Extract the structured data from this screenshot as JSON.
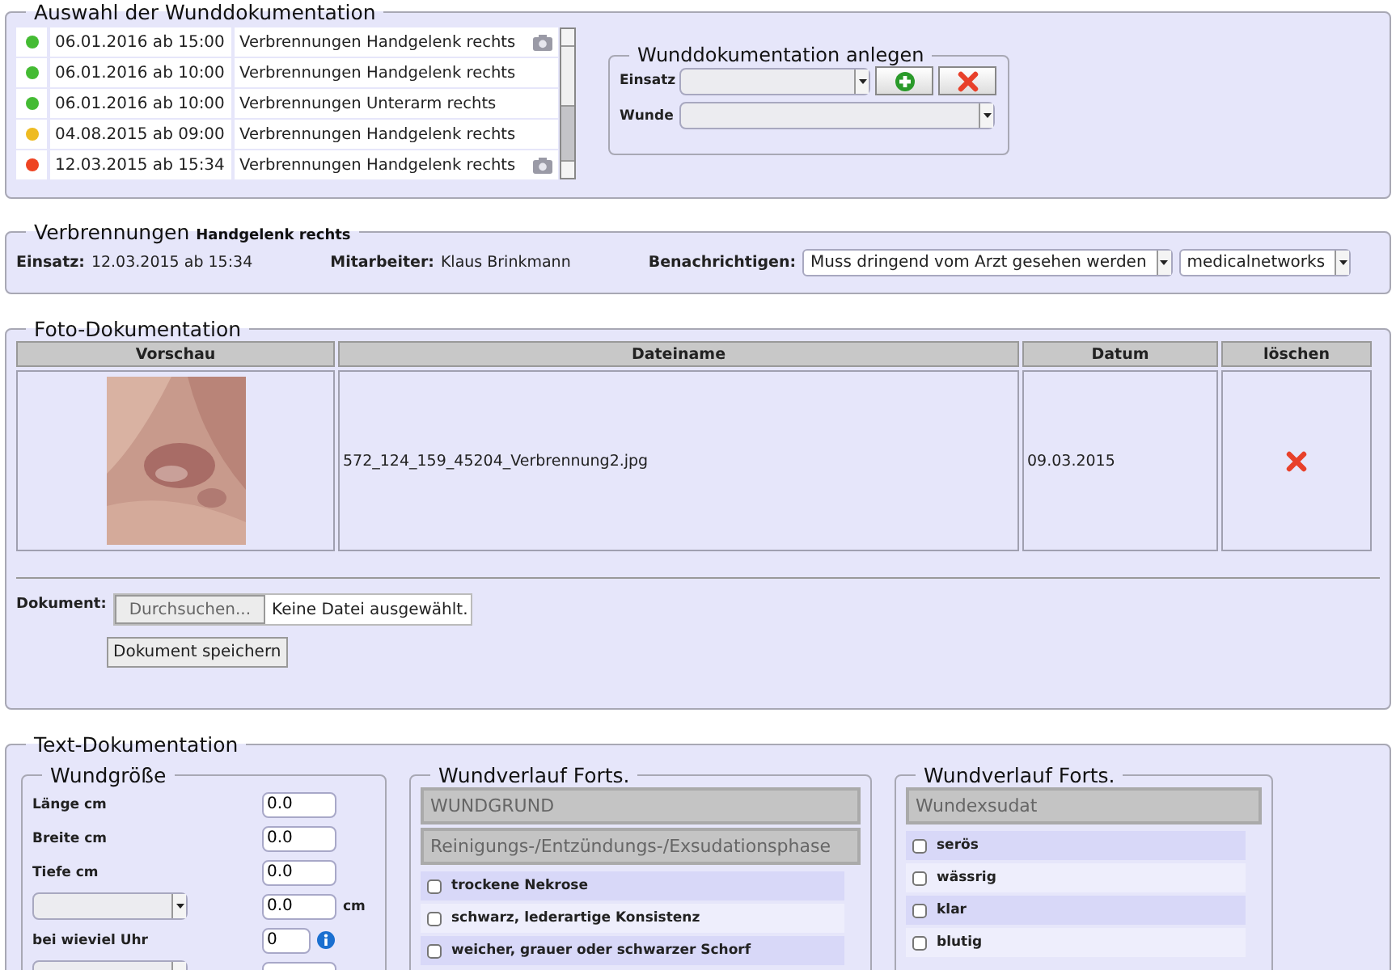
{
  "selection": {
    "legend": "Auswahl der Wunddokumentation",
    "entries": [
      {
        "color": "#44bb33",
        "date": "06.01.2016 ab 15:00",
        "description": "Verbrennungen Handgelenk rechts",
        "has_photo": true,
        "selected": false
      },
      {
        "color": "#44bb33",
        "date": "06.01.2016 ab 10:00",
        "description": "Verbrennungen Handgelenk rechts",
        "has_photo": false,
        "selected": false
      },
      {
        "color": "#44bb33",
        "date": "06.01.2016 ab 10:00",
        "description": "Verbrennungen Unterarm rechts",
        "has_photo": false,
        "selected": false
      },
      {
        "color": "#eebb22",
        "date": "04.08.2015 ab 09:00",
        "description": "Verbrennungen Handgelenk rechts",
        "has_photo": false,
        "selected": false
      },
      {
        "color": "#ee4422",
        "date": "12.03.2015 ab 15:34",
        "description": "Verbrennungen Handgelenk rechts",
        "has_photo": true,
        "selected": false
      }
    ],
    "create": {
      "legend": "Wunddokumentation anlegen",
      "fields": [
        {
          "label": "Einsatz",
          "kind": "select-actions"
        },
        {
          "label": "Wunde",
          "kind": "select"
        }
      ]
    }
  },
  "wound": {
    "title": "Verbrennungen",
    "subtitle": "Handgelenk rechts",
    "einsatz": {
      "label": "Einsatz:",
      "value": "12.03.2015 ab 15:34"
    },
    "mitarbeiter": {
      "label": "Mitarbeiter:",
      "value": "Klaus Brinkmann"
    },
    "notify": {
      "label": "Benachrichtigen:",
      "options": [
        "Muss dringend vom Arzt gesehen werden",
        "medicalnetworks"
      ]
    }
  },
  "photos": {
    "legend": "Foto-Dokumentation",
    "columns": [
      "Vorschau",
      "Dateiname",
      "Datum",
      "löschen"
    ],
    "rows": [
      {
        "filename": "572_124_159_45204_Verbrennung2.jpg",
        "date": "09.03.2015"
      }
    ],
    "document_label": "Dokument:",
    "browse_button": "Durchsuchen...",
    "file_status": "Keine Datei ausgewählt.",
    "save_button": "Dokument speichern"
  },
  "text_doc": {
    "legend": "Text-Dokumentation",
    "size": {
      "legend": "Wundgröße",
      "rows": [
        {
          "kind": "text",
          "label": "Länge cm",
          "value": "0.0"
        },
        {
          "kind": "text",
          "label": "Breite cm",
          "value": "0.0"
        },
        {
          "kind": "text",
          "label": "Tiefe cm",
          "value": "0.0"
        },
        {
          "kind": "select",
          "value": "0.0",
          "unit": "cm"
        },
        {
          "kind": "info",
          "label": "bei wieviel Uhr",
          "value": "0"
        },
        {
          "kind": "select"
        }
      ]
    },
    "panels": [
      {
        "legend": "Wundverlauf Forts.",
        "headers": [
          "WUNDGRUND",
          "Reinigungs-/Entzündungs-/Exsudationsphase"
        ],
        "options": [
          {
            "label": "trockene Nekrose",
            "checked": false
          },
          {
            "label": "schwarz, lederartige Konsistenz",
            "checked": false
          },
          {
            "label": "weicher, grauer oder schwarzer Schorf",
            "checked": false
          }
        ]
      },
      {
        "legend": "Wundverlauf Forts.",
        "headers": [
          "Wundexsudat"
        ],
        "options": [
          {
            "label": "serös",
            "checked": false
          },
          {
            "label": "wässrig",
            "checked": false
          },
          {
            "label": "klar",
            "checked": false
          },
          {
            "label": "blutig",
            "checked": false
          }
        ]
      }
    ]
  }
}
